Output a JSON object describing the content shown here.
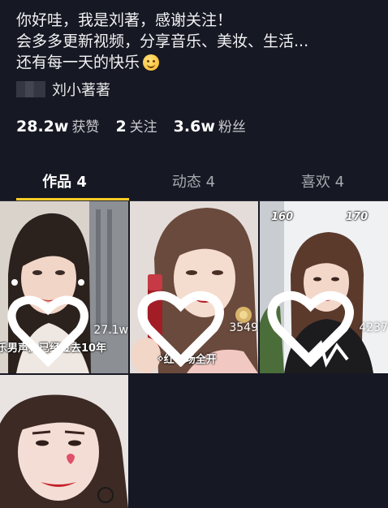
{
  "profile": {
    "bio_lines": [
      "你好哇，我是刘著，感谢关注！",
      "会多多更新视频，分享音乐、美妆、生活...",
      "还有每一天的快乐"
    ],
    "nickname": "刘小著著"
  },
  "stats": [
    {
      "value": "28.2w",
      "label": "获赞"
    },
    {
      "value": "2",
      "label": "关注"
    },
    {
      "value": "3.6w",
      "label": "粉丝"
    }
  ],
  "tabs": [
    {
      "label": "作品 4",
      "active": true
    },
    {
      "label": "动态 4",
      "active": false
    },
    {
      "label": "喜欢 4",
      "active": false
    }
  ],
  "videos": [
    {
      "likes": "27.1w",
      "overlay": "乐男声》已经过去10年"
    },
    {
      "likes": "3549",
      "overlay": "ᛜ红气场全开"
    },
    {
      "likes": "4237",
      "overlay_left": "160",
      "overlay_right": "170"
    },
    {
      "likes": ""
    }
  ],
  "colors": {
    "background": "#161823",
    "tab_indicator": "#facd28"
  }
}
